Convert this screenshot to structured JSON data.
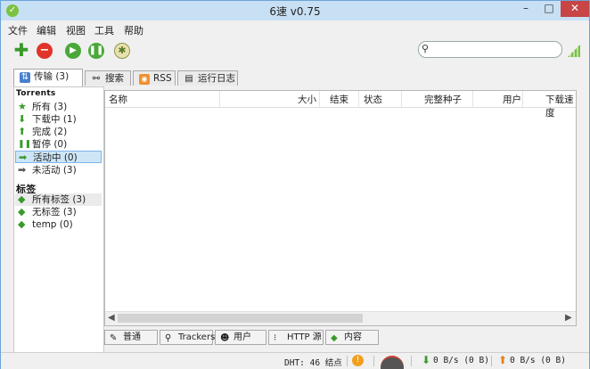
{
  "window": {
    "title": "6速 v0.75",
    "min_glyph": "–",
    "max_glyph": "□",
    "close_glyph": "✕"
  },
  "menu": [
    "文件",
    "编辑",
    "视图",
    "工具",
    "帮助"
  ],
  "search": {
    "placeholder": ""
  },
  "tabs": [
    {
      "label": "传输 (3)",
      "icon": "transfer-icon"
    },
    {
      "label": "搜索",
      "icon": "binoculars-icon"
    },
    {
      "label": "RSS",
      "icon": "rss-icon"
    },
    {
      "label": "运行日志",
      "icon": "log-icon"
    }
  ],
  "sidebar": {
    "torrents_heading": "Torrents",
    "items": [
      {
        "label": "所有 (3)",
        "icon": "star-icon"
      },
      {
        "label": "下载中 (1)",
        "icon": "arrow-down-icon"
      },
      {
        "label": "完成 (2)",
        "icon": "arrow-up-icon"
      },
      {
        "label": "暂停 (0)",
        "icon": "pause-icon"
      },
      {
        "label": "活动中 (0)",
        "icon": "arrow-right-icon"
      },
      {
        "label": "未活动 (3)",
        "icon": "arrow-right-icon"
      }
    ],
    "tags_heading": "标签",
    "tags": [
      {
        "label": "所有标签 (3)",
        "icon": "tag-icon"
      },
      {
        "label": "无标签 (3)",
        "icon": "tag-icon"
      },
      {
        "label": "temp (0)",
        "icon": "tag-icon"
      }
    ]
  },
  "table": {
    "columns": [
      "名称",
      "大小",
      "结束",
      "状态",
      "完整种子",
      "用户",
      "下载速度"
    ]
  },
  "bottom_tabs": [
    {
      "label": "普通",
      "icon": "pencil-icon"
    },
    {
      "label": "Trackers",
      "icon": "tracker-icon"
    },
    {
      "label": "用户",
      "icon": "users-icon"
    },
    {
      "label": "HTTP 源",
      "icon": "http-icon"
    },
    {
      "label": "内容",
      "icon": "tag-icon"
    }
  ],
  "status": {
    "dht": "DHT: 46 结点",
    "download": "0 B/s (0 B)",
    "upload": "0 B/s (0 B)"
  },
  "colors": {
    "accent": "#7cc242",
    "selection": "#cde6f7",
    "close": "#c74545"
  }
}
